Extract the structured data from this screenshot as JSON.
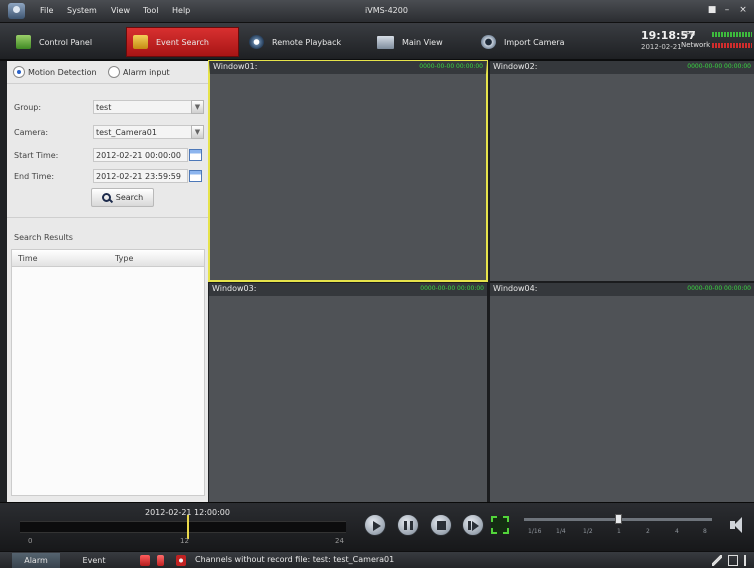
{
  "titlebar": {
    "app_title": "iVMS-4200",
    "menu": [
      "File",
      "System",
      "View",
      "Tool",
      "Help"
    ]
  },
  "tabs": [
    {
      "label": "Control Panel",
      "icon": "control-panel-icon"
    },
    {
      "label": "Event Search",
      "icon": "event-search-icon",
      "active": true
    },
    {
      "label": "Remote Playback",
      "icon": "remote-playback-icon"
    },
    {
      "label": "Main View",
      "icon": "main-view-icon"
    },
    {
      "label": "Import Camera",
      "icon": "import-camera-icon"
    }
  ],
  "clock": {
    "time": "19:18:57",
    "date": "2012-02-21"
  },
  "perf": {
    "cpu_label": "CPU",
    "network_label": "Network"
  },
  "search_panel": {
    "radio_motion": "Motion Detection",
    "radio_alarm": "Alarm input",
    "selected_mode": "Motion Detection",
    "group_label": "Group:",
    "group_value": "test",
    "camera_label": "Camera:",
    "camera_value": "test_Camera01",
    "start_label": "Start Time:",
    "start_value": "2012-02-21 00:00:00",
    "end_label": "End Time:",
    "end_value": "2012-02-21 23:59:59",
    "search_button": "Search",
    "results_title": "Search Results",
    "col_time": "Time",
    "col_type": "Type",
    "rows": []
  },
  "windows": [
    {
      "label": "Window01:",
      "timestamp": "0000-00-00 00:00:00",
      "selected": true
    },
    {
      "label": "Window02:",
      "timestamp": "0000-00-00 00:00:00",
      "selected": false
    },
    {
      "label": "Window03:",
      "timestamp": "0000-00-00 00:00:00",
      "selected": false
    },
    {
      "label": "Window04:",
      "timestamp": "0000-00-00 00:00:00",
      "selected": false
    }
  ],
  "playback": {
    "current_datetime": "2012-02-21 12:00:00",
    "timeline_ticks": [
      "0",
      "12",
      "24"
    ],
    "speed_labels": [
      "1/16",
      "1/4",
      "1/2",
      "1",
      "2",
      "4",
      "8"
    ]
  },
  "statusbar": {
    "tab_alarm": "Alarm",
    "tab_event": "Event",
    "message": "Channels without record file: test: test_Camera01"
  },
  "colors": {
    "active_tab": "#c52020",
    "selected_window_border": "#e6e34b",
    "timestamp_green": "#38d640",
    "panel_bg": "#e9e9e9"
  }
}
